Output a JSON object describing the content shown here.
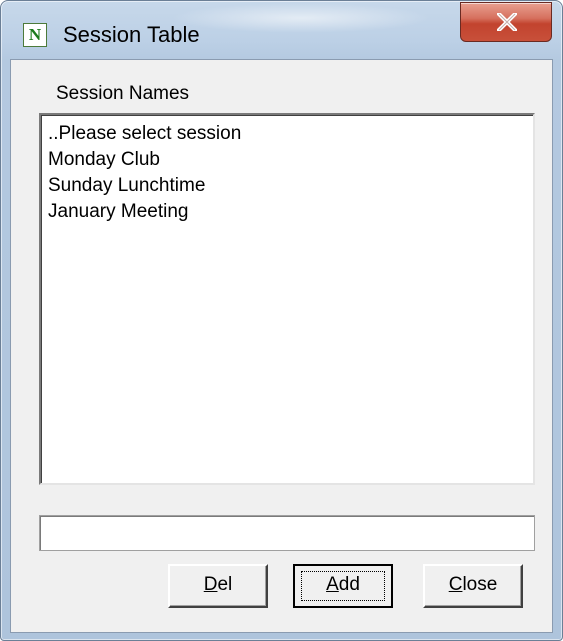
{
  "window": {
    "title": "Session Table",
    "icon_letter": "N",
    "close_icon": "close-x-icon"
  },
  "group": {
    "label": "Session Names"
  },
  "session_list": {
    "items": [
      {
        "label": "..Please select session"
      },
      {
        "label": "Monday Club"
      },
      {
        "label": "Sunday Lunchtime"
      },
      {
        "label": "January Meeting"
      }
    ]
  },
  "name_input": {
    "value": "",
    "placeholder": ""
  },
  "buttons": {
    "del": {
      "mnemonic": "D",
      "rest": "el"
    },
    "add": {
      "mnemonic": "A",
      "rest": "dd"
    },
    "close": {
      "mnemonic": "C",
      "rest": "lose"
    }
  },
  "colors": {
    "accent_icon": "#1c7a1c",
    "close_button": "#c7442f",
    "frame": "#b9cde3"
  }
}
